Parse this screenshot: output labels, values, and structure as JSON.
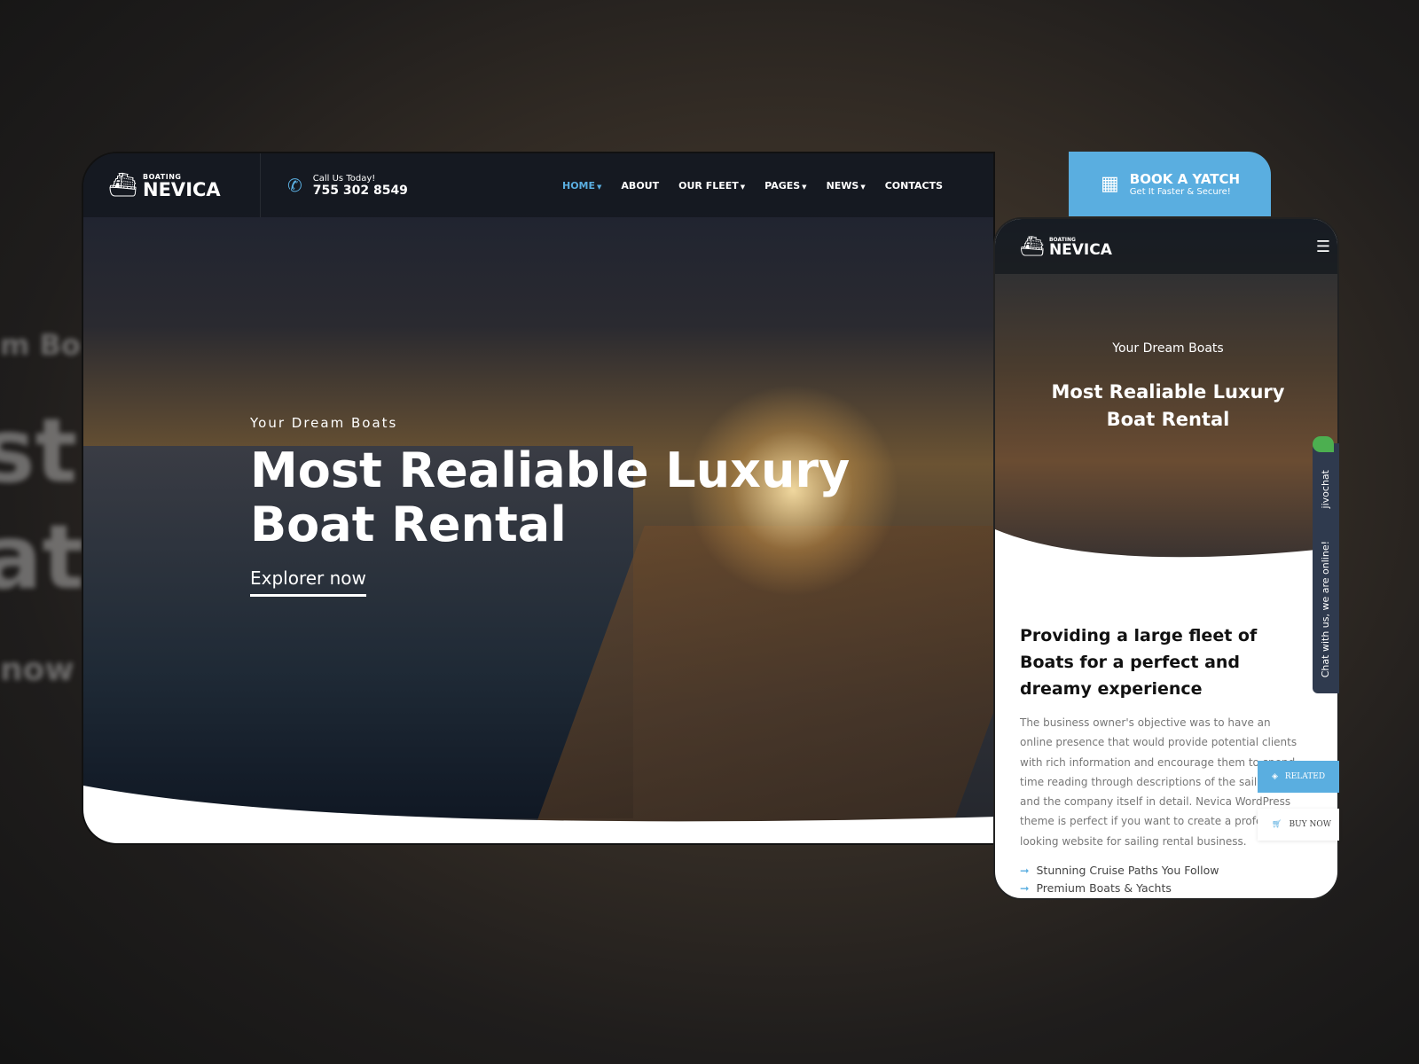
{
  "brand": {
    "small": "BOATING",
    "name": "NEVICA"
  },
  "contact": {
    "label": "Call Us Today!",
    "phone": "755 302 8549"
  },
  "nav": [
    {
      "label": "HOME",
      "caret": true,
      "active": true
    },
    {
      "label": "ABOUT"
    },
    {
      "label": "OUR FLEET",
      "caret": true
    },
    {
      "label": "PAGES",
      "caret": true
    },
    {
      "label": "NEWS",
      "caret": true
    },
    {
      "label": "CONTACTS"
    }
  ],
  "book": {
    "title": "BOOK A YATCH",
    "subtitle": "Get It Faster & Secure!"
  },
  "hero": {
    "subtitle": "Your Dream Boats",
    "title_line1": "Most Realiable Luxury",
    "title_line2": "Boat Rental",
    "cta": "Explorer now"
  },
  "mobile": {
    "subtitle": "Your Dream Boats",
    "title_line1": "Most Realiable Luxury",
    "title_line2": "Boat Rental",
    "heading": "Providing a large fleet of Boats for a perfect and dreamy experience",
    "paragraph": "The business owner's objective was to have an online presence that would provide potential clients with rich information and encourage them to spend time reading through descriptions of the sailboats and the company itself in detail. Nevica WordPress theme is perfect if you want to create a professional looking website for sailing rental business.",
    "list": [
      "Stunning Cruise Paths You Follow",
      "Premium Boats & Yachts"
    ]
  },
  "chat": {
    "brand": "jivochat",
    "text": "Chat with us, we are online!"
  },
  "side": {
    "related": "RELATED",
    "buy": "BUY NOW"
  },
  "background": {
    "text1": "st",
    "text2": "at",
    "text3": "now",
    "text4": "m Bo"
  },
  "colors": {
    "accent": "#5aaee0",
    "chat": "#2f3a4e"
  }
}
